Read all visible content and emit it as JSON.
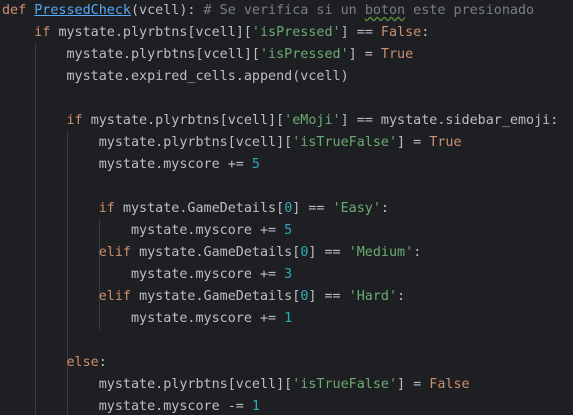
{
  "lines": [
    [
      {
        "t": "def ",
        "c": "kw"
      },
      {
        "t": "PressedCheck",
        "c": "fn"
      },
      {
        "t": "(vcell):",
        "c": "plain"
      },
      {
        "t": " # Se verifica si un ",
        "c": "cmt"
      },
      {
        "t": "boton",
        "c": "cmt warn"
      },
      {
        "t": " este presionado",
        "c": "cmt"
      }
    ],
    [
      {
        "t": "    ",
        "c": "plain"
      },
      {
        "t": "if ",
        "c": "kw"
      },
      {
        "t": "mystate.plyrbtns[vcell][",
        "c": "plain"
      },
      {
        "t": "'isPressed'",
        "c": "str"
      },
      {
        "t": "] == ",
        "c": "plain"
      },
      {
        "t": "False",
        "c": "kw"
      },
      {
        "t": ":",
        "c": "plain"
      }
    ],
    [
      {
        "t": "        mystate.plyrbtns[vcell][",
        "c": "plain"
      },
      {
        "t": "'isPressed'",
        "c": "str"
      },
      {
        "t": "] = ",
        "c": "plain"
      },
      {
        "t": "True",
        "c": "kw"
      }
    ],
    [
      {
        "t": "        mystate.expired_cells.append(vcell)",
        "c": "plain"
      }
    ],
    [],
    [
      {
        "t": "        ",
        "c": "plain"
      },
      {
        "t": "if ",
        "c": "kw"
      },
      {
        "t": "mystate.plyrbtns[vcell][",
        "c": "plain"
      },
      {
        "t": "'eMoji'",
        "c": "str"
      },
      {
        "t": "] == mystate.sidebar_emoji:",
        "c": "plain"
      }
    ],
    [
      {
        "t": "            mystate.plyrbtns[vcell][",
        "c": "plain"
      },
      {
        "t": "'isTrueFalse'",
        "c": "str"
      },
      {
        "t": "] = ",
        "c": "plain"
      },
      {
        "t": "True",
        "c": "kw"
      }
    ],
    [
      {
        "t": "            mystate.myscore += ",
        "c": "plain"
      },
      {
        "t": "5",
        "c": "num"
      }
    ],
    [],
    [
      {
        "t": "            ",
        "c": "plain"
      },
      {
        "t": "if ",
        "c": "kw"
      },
      {
        "t": "mystate.GameDetails[",
        "c": "plain"
      },
      {
        "t": "0",
        "c": "num"
      },
      {
        "t": "] == ",
        "c": "plain"
      },
      {
        "t": "'Easy'",
        "c": "str"
      },
      {
        "t": ":",
        "c": "plain"
      }
    ],
    [
      {
        "t": "                mystate.myscore += ",
        "c": "plain"
      },
      {
        "t": "5",
        "c": "num"
      }
    ],
    [
      {
        "t": "            ",
        "c": "plain"
      },
      {
        "t": "elif ",
        "c": "kw"
      },
      {
        "t": "mystate.GameDetails[",
        "c": "plain"
      },
      {
        "t": "0",
        "c": "num"
      },
      {
        "t": "] == ",
        "c": "plain"
      },
      {
        "t": "'Medium'",
        "c": "str"
      },
      {
        "t": ":",
        "c": "plain"
      }
    ],
    [
      {
        "t": "                mystate.myscore += ",
        "c": "plain"
      },
      {
        "t": "3",
        "c": "num"
      }
    ],
    [
      {
        "t": "            ",
        "c": "plain"
      },
      {
        "t": "elif ",
        "c": "kw"
      },
      {
        "t": "mystate.GameDetails[",
        "c": "plain"
      },
      {
        "t": "0",
        "c": "num"
      },
      {
        "t": "] == ",
        "c": "plain"
      },
      {
        "t": "'Hard'",
        "c": "str"
      },
      {
        "t": ":",
        "c": "plain"
      }
    ],
    [
      {
        "t": "                mystate.myscore += ",
        "c": "plain"
      },
      {
        "t": "1",
        "c": "num"
      }
    ],
    [],
    [
      {
        "t": "        ",
        "c": "plain"
      },
      {
        "t": "else",
        "c": "kw"
      },
      {
        "t": ":",
        "c": "plain"
      }
    ],
    [
      {
        "t": "            mystate.plyrbtns[vcell][",
        "c": "plain"
      },
      {
        "t": "'isTrueFalse'",
        "c": "str"
      },
      {
        "t": "] = ",
        "c": "plain"
      },
      {
        "t": "False",
        "c": "kw"
      }
    ],
    [
      {
        "t": "            mystate.myscore -= ",
        "c": "plain"
      },
      {
        "t": "1",
        "c": "num"
      }
    ]
  ]
}
